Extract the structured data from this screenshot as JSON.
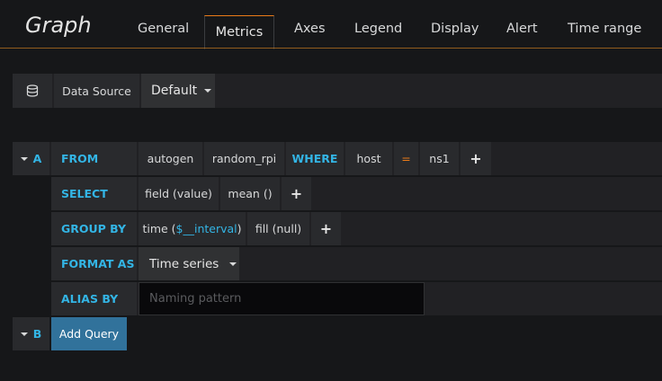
{
  "panel": {
    "title": "Graph"
  },
  "tabs": [
    "General",
    "Metrics",
    "Axes",
    "Legend",
    "Display",
    "Alert",
    "Time range"
  ],
  "datasource": {
    "label": "Data Source",
    "value": "Default"
  },
  "query_a": {
    "letter": "A",
    "from_label": "FROM",
    "policy": "autogen",
    "measurement": "random_rpi",
    "where_label": "WHERE",
    "tag_key": "host",
    "operator": "=",
    "tag_value": "ns1",
    "add": "+",
    "select_label": "SELECT",
    "field": "field (value)",
    "func": "mean ()",
    "group_label": "GROUP BY",
    "time_prefix": "time (",
    "time_var": "$__interval",
    "time_suffix": ")",
    "fill": "fill (null)",
    "format_label": "FORMAT AS",
    "format_value": "Time series",
    "alias_label": "ALIAS BY",
    "alias_placeholder": "Naming pattern"
  },
  "query_b": {
    "letter": "B",
    "add_query": "Add Query"
  },
  "colors": {
    "accent": "#33b5e5",
    "tab_highlight": "#eb7b18",
    "button": "#31729b"
  }
}
